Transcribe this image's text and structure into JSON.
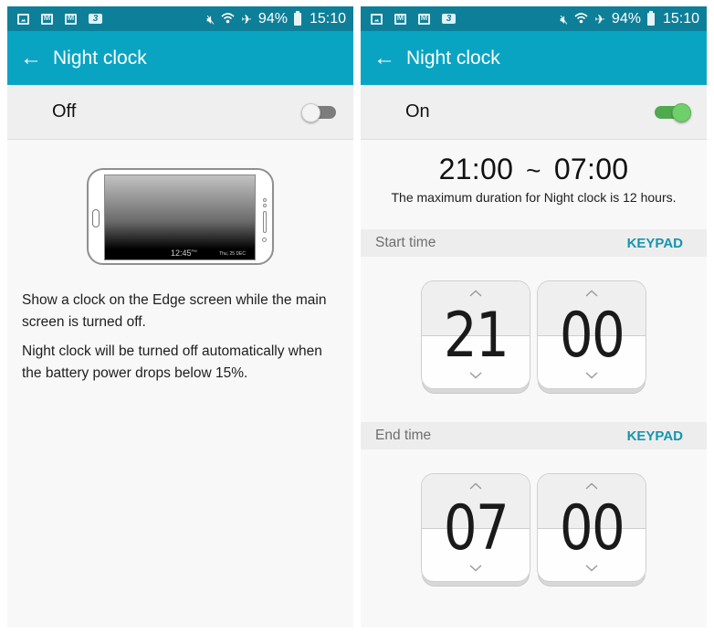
{
  "status_bar": {
    "notification_icons": [
      "gallery-icon",
      "gmail-icon",
      "gmail-icon",
      "3g-icon"
    ],
    "system_icons": [
      "mute-icon",
      "wifi-icon",
      "airplane-icon"
    ],
    "battery": "94%",
    "time": "15:10"
  },
  "colors": {
    "status_bar": "#0e7f98",
    "app_bar": "#0aa4c3",
    "switch_on": "#6fcf6a",
    "keypad_link": "#1795ad"
  },
  "left_screen": {
    "title": "Night clock",
    "toggle_label": "Off",
    "toggle_on": false,
    "illustration": {
      "time": "12:45",
      "time_suffix": "PM",
      "date": "Thu, 25 DEC"
    },
    "description": [
      "Show a clock on the Edge screen while the main screen is turned off.",
      "Night clock will be turned off automatically when the battery power drops below 15%."
    ]
  },
  "right_screen": {
    "title": "Night clock",
    "toggle_label": "On",
    "toggle_on": true,
    "range": {
      "start": "21:00",
      "separator": "~",
      "end": "07:00"
    },
    "range_note": "The maximum duration for Night clock is 12 hours.",
    "start_time": {
      "label": "Start time",
      "keypad_label": "KEYPAD",
      "hour": "21",
      "minute": "00"
    },
    "end_time": {
      "label": "End time",
      "keypad_label": "KEYPAD",
      "hour": "07",
      "minute": "00"
    }
  }
}
